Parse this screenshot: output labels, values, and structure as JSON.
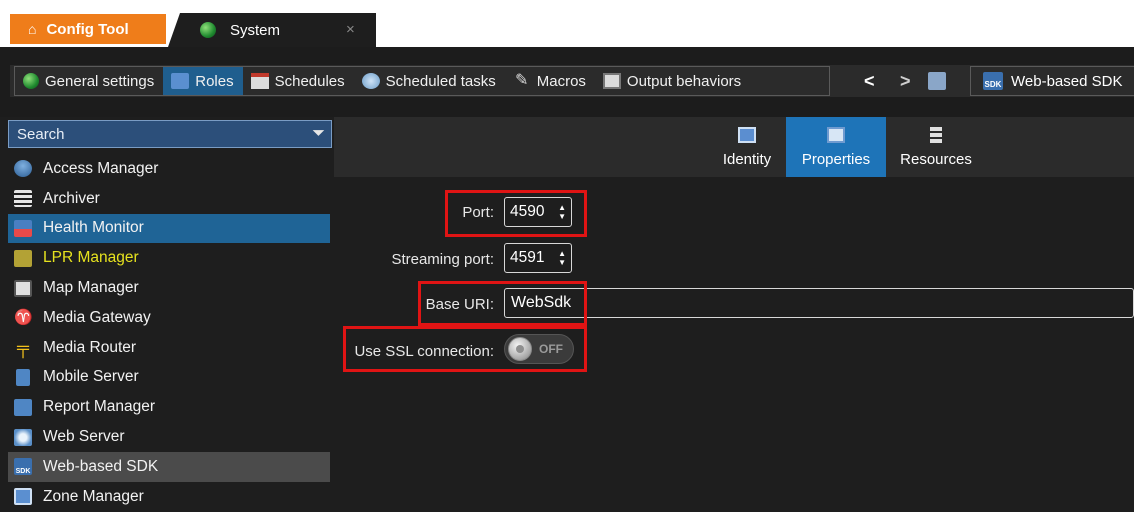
{
  "tabs": {
    "config_tool": "Config Tool",
    "system": "System",
    "close_symbol": "×"
  },
  "toolbar": {
    "items": [
      {
        "label": "General settings",
        "icon": "globe-icon"
      },
      {
        "label": "Roles",
        "icon": "roles-icon",
        "active": true
      },
      {
        "label": "Schedules",
        "icon": "calendar-icon"
      },
      {
        "label": "Scheduled tasks",
        "icon": "task-icon"
      },
      {
        "label": "Macros",
        "icon": "macro-icon"
      },
      {
        "label": "Output behaviors",
        "icon": "output-icon"
      }
    ],
    "back_symbol": "<",
    "forward_symbol": ">",
    "breadcrumb": "Web-based SDK"
  },
  "search": {
    "placeholder": "Search"
  },
  "roles": [
    {
      "label": "Access Manager"
    },
    {
      "label": "Archiver"
    },
    {
      "label": "Health Monitor",
      "selected": "blue"
    },
    {
      "label": "LPR Manager",
      "color": "#e6e21e"
    },
    {
      "label": "Map Manager"
    },
    {
      "label": "Media Gateway"
    },
    {
      "label": "Media Router"
    },
    {
      "label": "Mobile Server"
    },
    {
      "label": "Report Manager"
    },
    {
      "label": "Web Server"
    },
    {
      "label": "Web-based SDK",
      "selected": "gray"
    },
    {
      "label": "Zone Manager"
    }
  ],
  "subtabs": {
    "identity": "Identity",
    "properties": "Properties",
    "resources": "Resources"
  },
  "form": {
    "port_label": "Port:",
    "port_value": "4590",
    "streaming_port_label": "Streaming port:",
    "streaming_port_value": "4591",
    "base_uri_label": "Base URI:",
    "base_uri_value": "WebSdk",
    "ssl_label": "Use SSL connection:",
    "ssl_state": "OFF"
  },
  "colors": {
    "accent_orange": "#ef7d1a",
    "selected_blue": "#1f6496",
    "highlight_red": "#e01414",
    "lpr_yellow": "#e6e21e"
  }
}
